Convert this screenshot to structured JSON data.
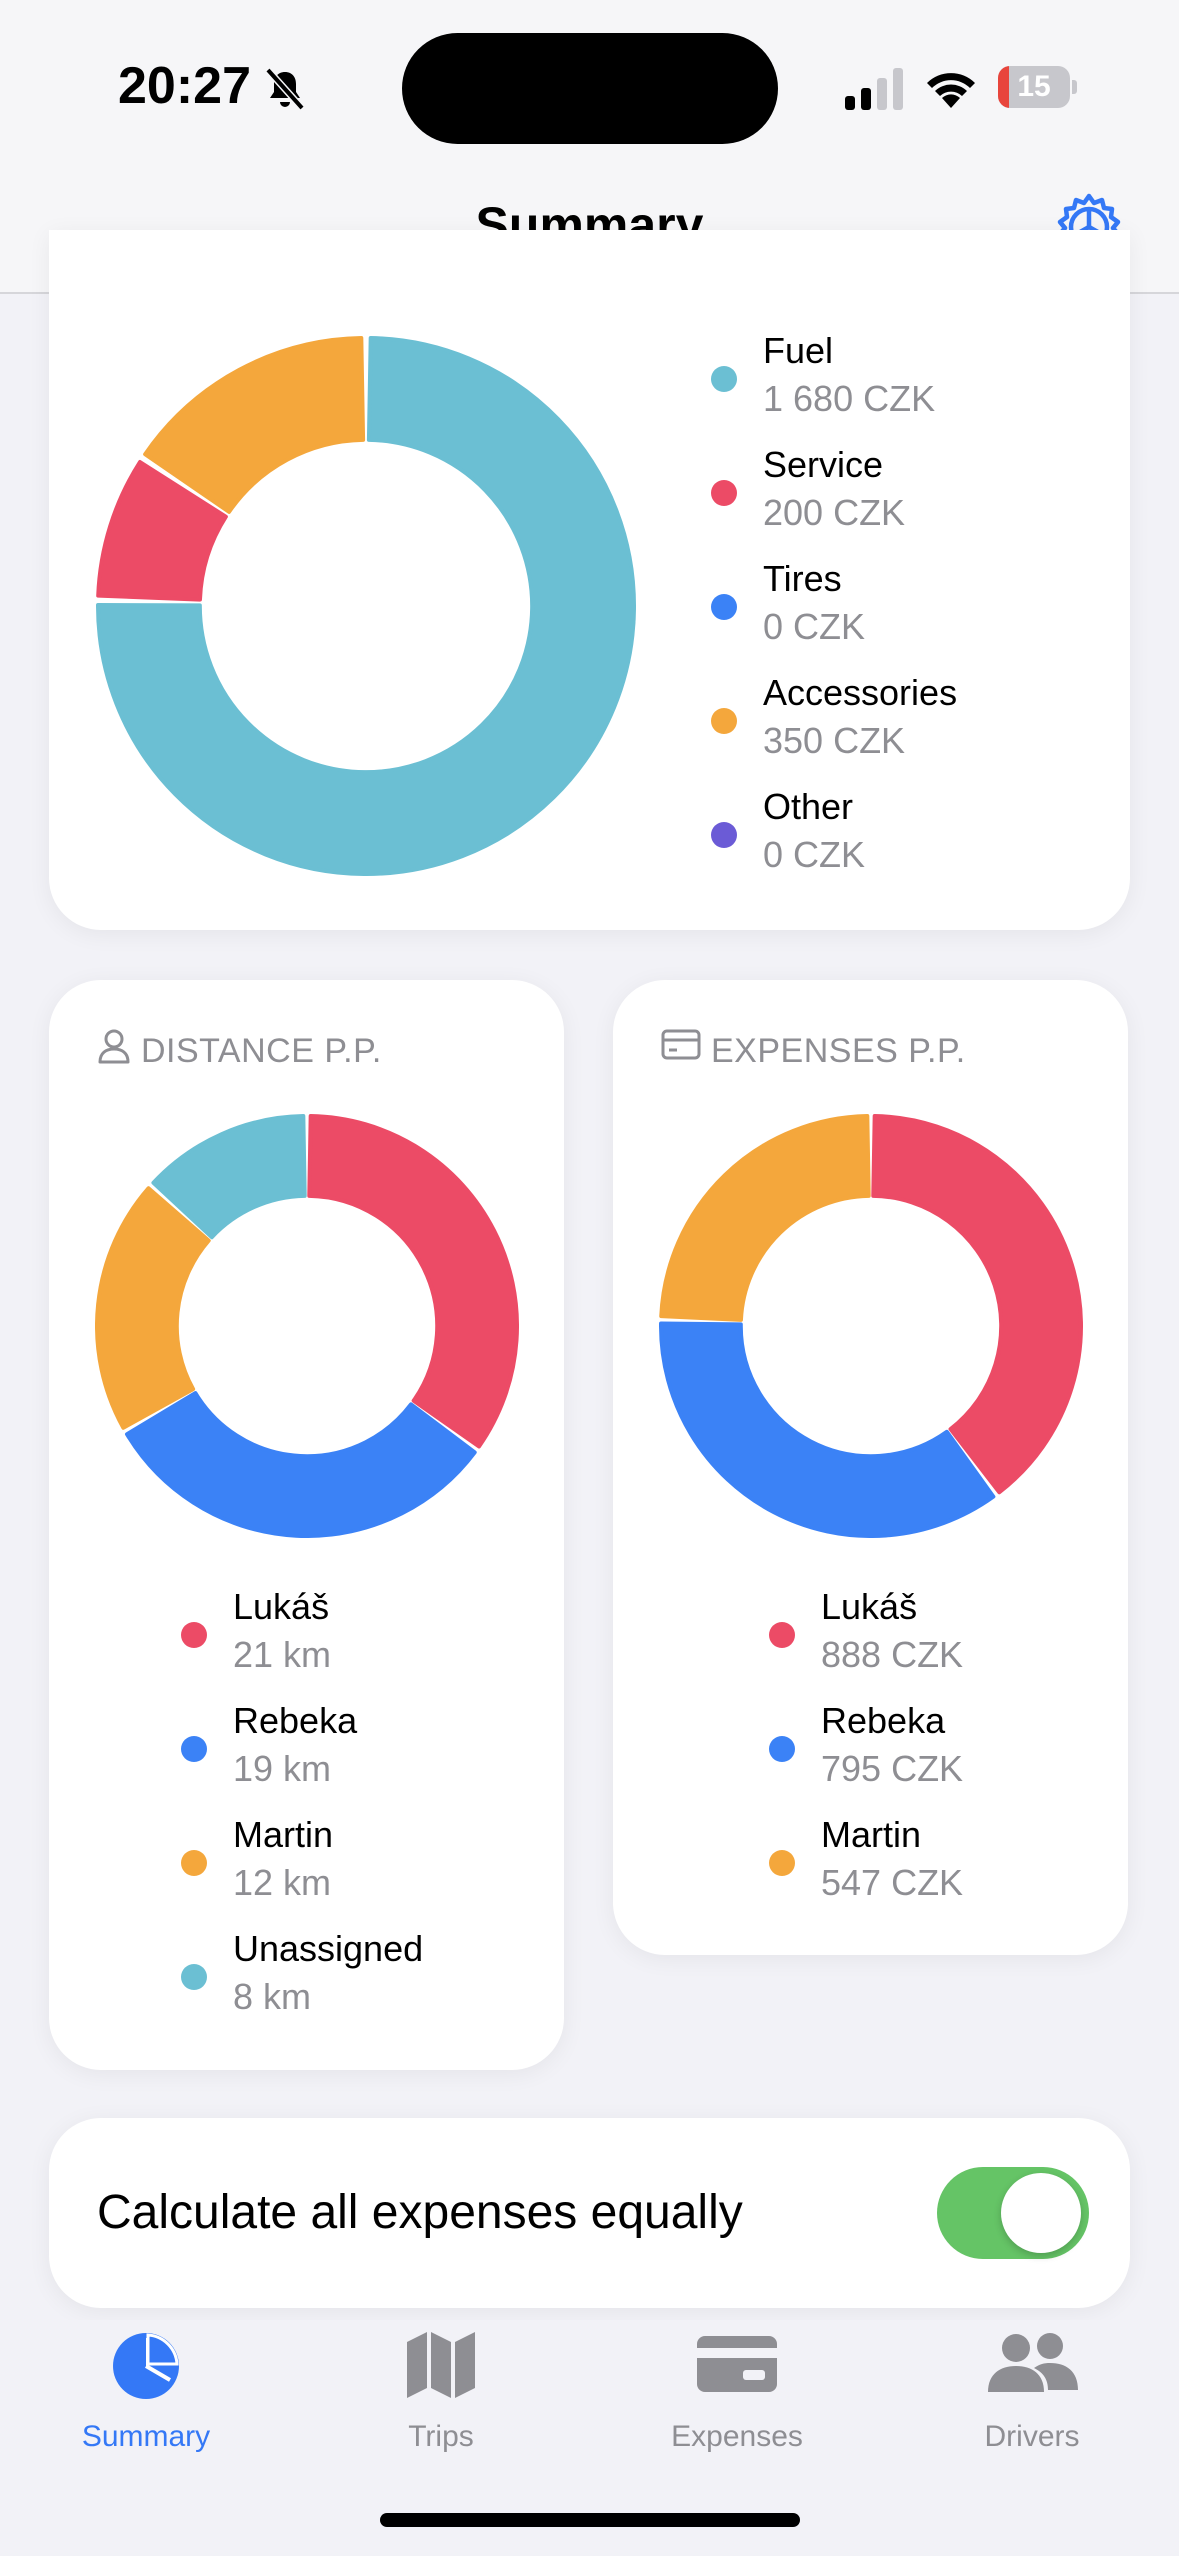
{
  "status_bar": {
    "time": "20:27",
    "battery_level": "15",
    "battery_fraction": 0.15
  },
  "nav": {
    "title": "Summary"
  },
  "expense_breakdown": {
    "items": [
      {
        "label": "Fuel",
        "value": "1 680 CZK",
        "amount": 1680,
        "color": "#6bbfd3"
      },
      {
        "label": "Service",
        "value": "200 CZK",
        "amount": 200,
        "color": "#ec4b66"
      },
      {
        "label": "Tires",
        "value": "0 CZK",
        "amount": 0,
        "color": "#3b82f6"
      },
      {
        "label": "Accessories",
        "value": "350 CZK",
        "amount": 350,
        "color": "#f4a73c"
      },
      {
        "label": "Other",
        "value": "0 CZK",
        "amount": 0,
        "color": "#6b5bd6"
      }
    ]
  },
  "distance_pp": {
    "header": "DISTANCE P.P.",
    "items": [
      {
        "label": "Lukáš",
        "value": "21 km",
        "amount": 21,
        "color": "#ec4b66"
      },
      {
        "label": "Rebeka",
        "value": "19 km",
        "amount": 19,
        "color": "#3b82f6"
      },
      {
        "label": "Martin",
        "value": "12 km",
        "amount": 12,
        "color": "#f4a73c"
      },
      {
        "label": "Unassigned",
        "value": "8 km",
        "amount": 8,
        "color": "#6bbfd3"
      }
    ]
  },
  "expenses_pp": {
    "header": "EXPENSES P.P.",
    "items": [
      {
        "label": "Lukáš",
        "value": "888 CZK",
        "amount": 888,
        "color": "#ec4b66"
      },
      {
        "label": "Rebeka",
        "value": "795 CZK",
        "amount": 795,
        "color": "#3b82f6"
      },
      {
        "label": "Martin",
        "value": "547 CZK",
        "amount": 547,
        "color": "#f4a73c"
      }
    ]
  },
  "settings_toggle": {
    "label": "Calculate all expenses equally",
    "on": true
  },
  "tabs": [
    {
      "label": "Summary",
      "icon": "pie-chart-icon",
      "active": true
    },
    {
      "label": "Trips",
      "icon": "map-icon",
      "active": false
    },
    {
      "label": "Expenses",
      "icon": "credit-card-icon",
      "active": false
    },
    {
      "label": "Drivers",
      "icon": "people-icon",
      "active": false
    }
  ],
  "colors": {
    "accent": "#3478f6",
    "toggle_on": "#65c466"
  }
}
